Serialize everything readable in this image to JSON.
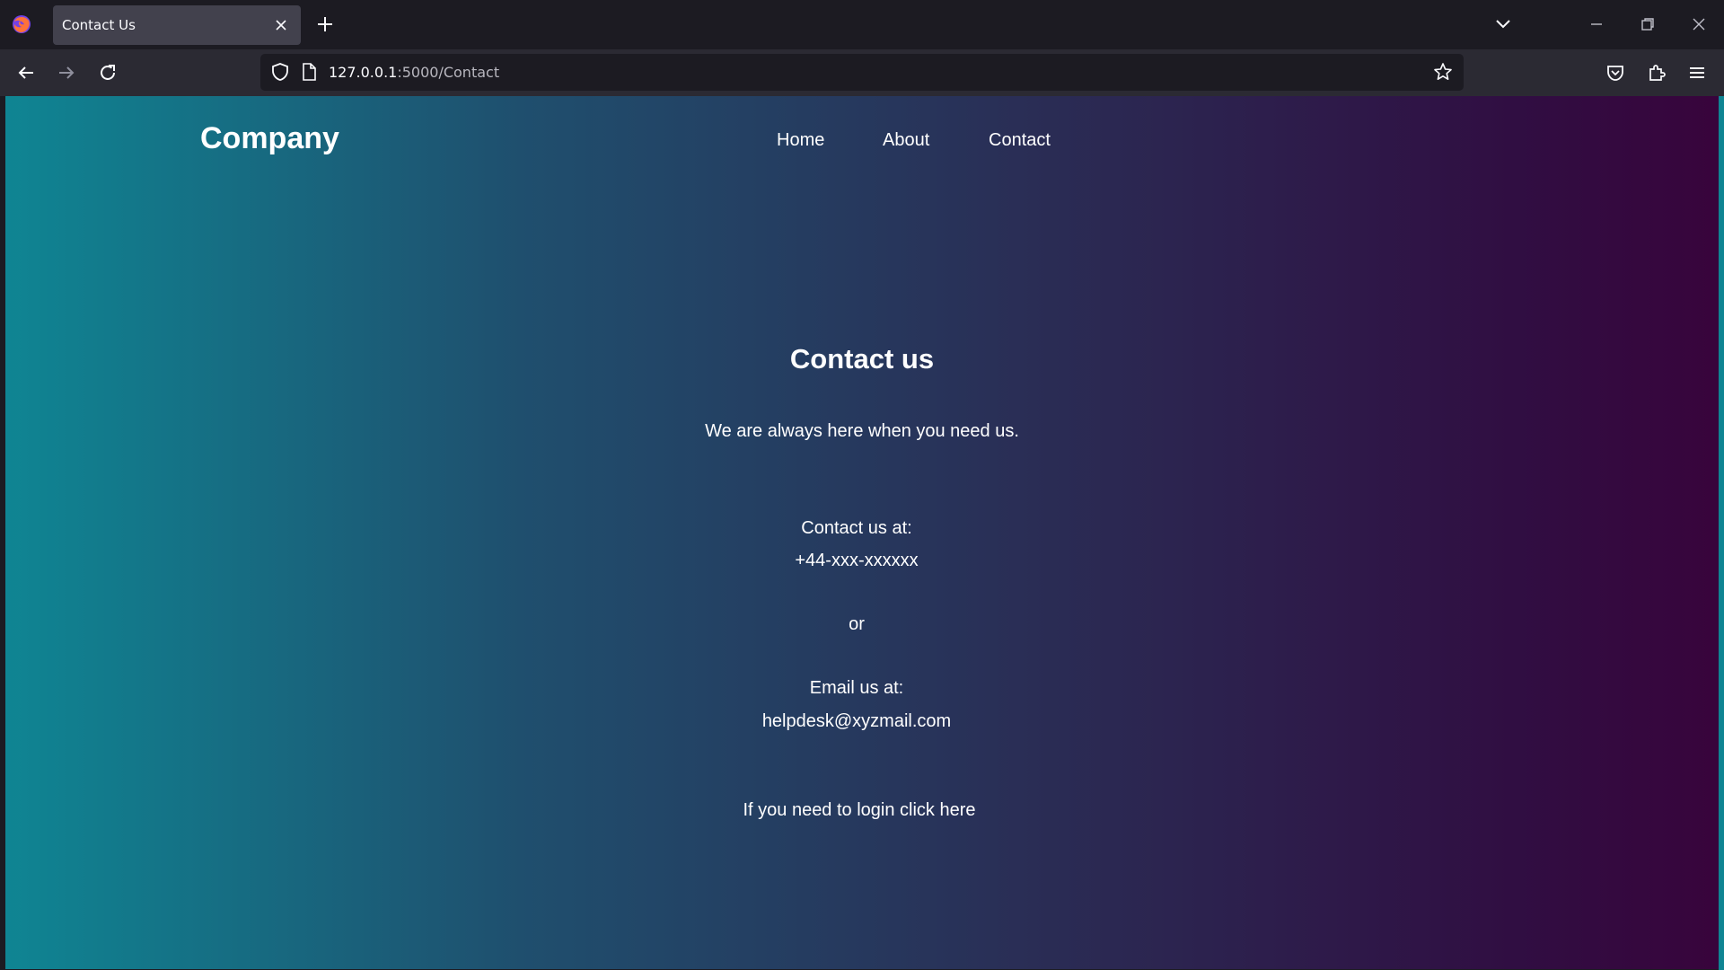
{
  "browser": {
    "tab_title": "Contact Us",
    "url_host": "127.0.0.1",
    "url_path": ":5000/Contact"
  },
  "site": {
    "brand": "Company",
    "nav": {
      "home": "Home",
      "about": "About",
      "contact": "Contact"
    }
  },
  "contact": {
    "heading": "Contact us",
    "subtitle": "We are always here when you need us.",
    "phone_label": "Contact us at:",
    "phone": "+44-xxx-xxxxxx",
    "or": "or",
    "email_label": "Email us at:",
    "email": "helpdesk@xyzmail.com",
    "login_text": "If you need to login ",
    "login_link": "click here"
  },
  "colors": {
    "gradient_start": "#0f8593",
    "gradient_end": "#38043c",
    "chrome_dark": "#1c1b22",
    "chrome_toolbar": "#2b2a33",
    "tab_active": "#42414d"
  }
}
